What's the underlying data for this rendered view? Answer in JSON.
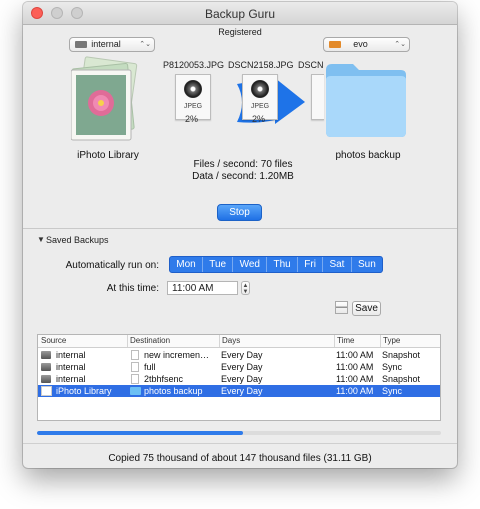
{
  "window": {
    "title": "Backup Guru",
    "registered": "Registered"
  },
  "source": {
    "drive": "internal",
    "library_label": "iPhoto Library"
  },
  "destination": {
    "drive": "evo",
    "folder_label": "photos backup"
  },
  "transfer": {
    "files": [
      {
        "name": "P8120053.JPG",
        "type": "JPEG",
        "percent": "2%"
      },
      {
        "name": "DSCN2158.JPG",
        "type": "JPEG",
        "percent": "2%"
      },
      {
        "name": "DSCN"
      }
    ],
    "files_per_second": "Files / second: 70 files",
    "data_per_second": "Data / second: 1.20MB",
    "stop_label": "Stop"
  },
  "saved_backups": {
    "section_label": "Saved Backups",
    "auto_run_label": "Automatically run on:",
    "days": [
      "Mon",
      "Tue",
      "Wed",
      "Thu",
      "Fri",
      "Sat",
      "Sun"
    ],
    "time_label": "At this time:",
    "time_value": "11:00 AM",
    "remove_label": "—",
    "save_label": "Save"
  },
  "table": {
    "columns": [
      "Source",
      "Destination",
      "Days",
      "Time",
      "Type"
    ],
    "rows": [
      {
        "source": "internal",
        "destination": "new incremen…",
        "days": "Every Day",
        "time": "11:00 AM",
        "type": "Snapshot",
        "selected": false
      },
      {
        "source": "internal",
        "destination": "full",
        "days": "Every Day",
        "time": "11:00 AM",
        "type": "Sync",
        "selected": false
      },
      {
        "source": "internal",
        "destination": "2tbhfsenc",
        "days": "Every Day",
        "time": "11:00 AM",
        "type": "Snapshot",
        "selected": false
      },
      {
        "source": "iPhoto Library",
        "destination": "photos backup",
        "days": "Every Day",
        "time": "11:00 AM",
        "type": "Sync",
        "selected": true
      }
    ]
  },
  "progress": {
    "fraction": 0.51
  },
  "status": "Copied 75 thousand of about 147 thousand files (31.11 GB)",
  "colors": {
    "accent": "#2f7bea",
    "selection": "#2f6ee4",
    "close": "#fc5f57"
  }
}
